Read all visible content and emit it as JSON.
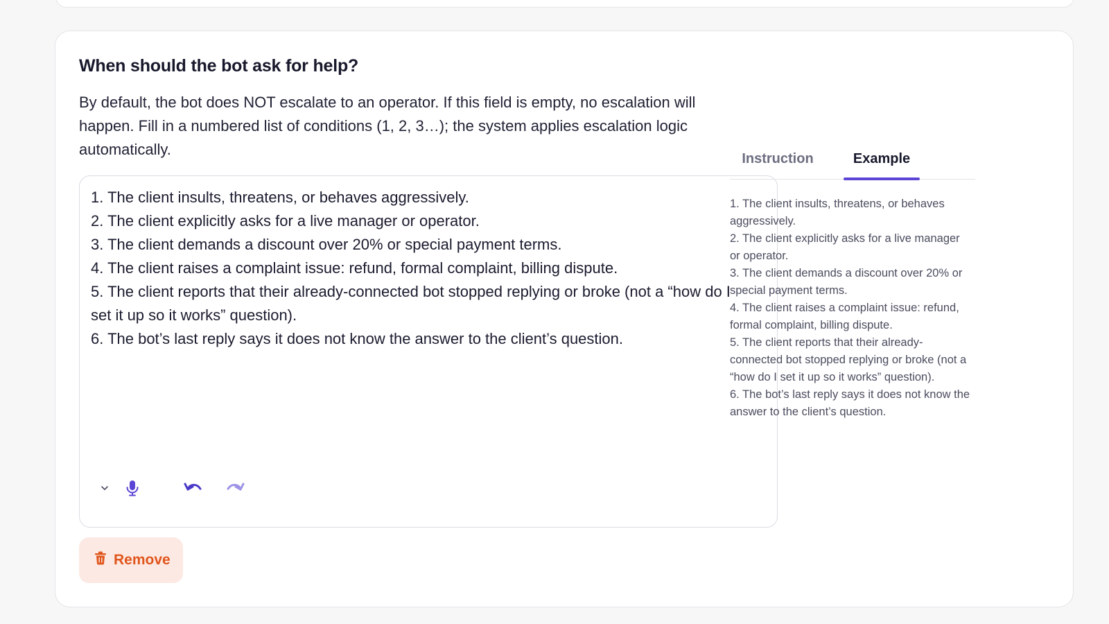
{
  "section": {
    "title": "When should the bot ask for help?",
    "description": "By default, the bot does NOT escalate to an operator. If this field is empty, no escalation will happen. Fill in a numbered list of conditions (1, 2, 3…); the system applies escalation logic automatically."
  },
  "editor": {
    "value": "1. The client insults, threatens, or behaves aggressively.\n2. The client explicitly asks for a live manager or operator.\n3. The client demands a discount over 20% or special payment terms.\n4. The client raises a complaint issue: refund, formal complaint, billing dispute.\n5. The client reports that their already-connected bot stopped replying or broke (not a “how do I set it up so it works” question).\n6. The bot’s last reply says it does not know the answer to the client’s question.",
    "toolbar": {
      "icons": [
        "chevron-down-icon",
        "microphone-icon",
        "undo-icon",
        "redo-icon"
      ]
    }
  },
  "remove_button": {
    "label": "Remove",
    "icon": "trash-icon"
  },
  "tabs": [
    {
      "label": "Instruction",
      "active": false
    },
    {
      "label": "Example",
      "active": true
    }
  ],
  "example": {
    "text": "1. The client insults, threatens, or behaves aggressively.\n2. The client explicitly asks for a live manager or operator.\n3. The client demands a discount over 20% or special payment terms.\n4. The client raises a complaint issue: refund, formal complaint, billing dispute.\n5. The client reports that their already-connected bot stopped replying or broke (not a “how do I set it up so it works” question).\n6. The bot’s last reply says it does not know the answer to the client’s question."
  },
  "colors": {
    "accent": "#5a45d6",
    "danger_text": "#e0561d",
    "danger_bg": "#fde9e3"
  }
}
